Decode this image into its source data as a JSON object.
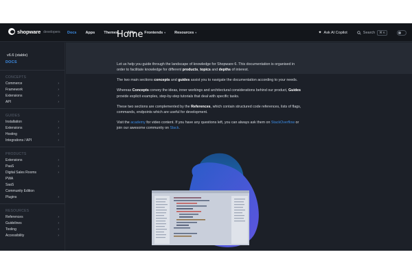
{
  "brand": {
    "name": "shopware",
    "sub": "developers"
  },
  "nav": [
    {
      "label": "Docs",
      "active": true,
      "dropdown": false
    },
    {
      "label": "Apps",
      "active": false,
      "dropdown": false
    },
    {
      "label": "Themes",
      "active": false,
      "dropdown": false
    },
    {
      "label": "APIs",
      "active": false,
      "dropdown": false
    },
    {
      "label": "Frontends",
      "active": false,
      "dropdown": true
    },
    {
      "label": "Resources",
      "active": false,
      "dropdown": true
    }
  ],
  "tools": {
    "ai_label": "Ask AI Copilot",
    "search_label": "Search",
    "search_kbd": "⌘ K"
  },
  "sidebar": {
    "version": "v6.6 (stable)",
    "docs": "DOCS",
    "sections": [
      {
        "title": "CONCEPTS",
        "items": [
          "Commerce",
          "Framework",
          "Extensions",
          "API"
        ]
      },
      {
        "title": "GUIDES",
        "items": [
          "Installation",
          "Extensions",
          "Hosting",
          "Integrations / API"
        ]
      },
      {
        "title": "PRODUCTS",
        "items": [
          "Extensions",
          "PaaS",
          "Digital Sales Rooms",
          "PWA",
          "SaaS",
          "Community Edition",
          "Plugins"
        ]
      },
      {
        "title": "RESOURCES",
        "items": [
          "References",
          "Guidelines",
          "Tooling",
          "Accessibility"
        ]
      }
    ]
  },
  "page": {
    "title": "Home",
    "p1": {
      "a": "Let us help you guide through the landscape of knowledge for Shopware 6. This documentation is organised in order to facilitate knowledge for different ",
      "b1": "products",
      "c": ", ",
      "b2": "topics",
      "d": " and ",
      "b3": "depths",
      "e": " of interest."
    },
    "p2": {
      "a": "The two main sections ",
      "b1": "concepts",
      "c": " and ",
      "b2": "guides",
      "d": " assist you to navigate the documentation according to your needs."
    },
    "p3": {
      "a": "Whereas ",
      "b1": "Concepts",
      "c": " convey the ideas, inner workings and architectural considerations behind our product, ",
      "b2": "Guides",
      "d": " provide explicit examples, step-by-step tutorials that deal with specific tasks."
    },
    "p4": {
      "a": "These two sections are complemented by the ",
      "b1": "References",
      "c": ", which contain structured code references, lists of flags, commands, endpoints which are useful for development."
    },
    "p5": {
      "a": "Visit the ",
      "l1": "academy",
      "c": " for video content. If you have any questions left, you can always ask them on ",
      "l2": "StackOverflow",
      "d": " or join our awesome community on ",
      "l3": "Slack",
      "e": "."
    }
  },
  "colors": {
    "accent": "#3d8ee8",
    "bg": "#1c2028",
    "topbar": "#13161b"
  }
}
